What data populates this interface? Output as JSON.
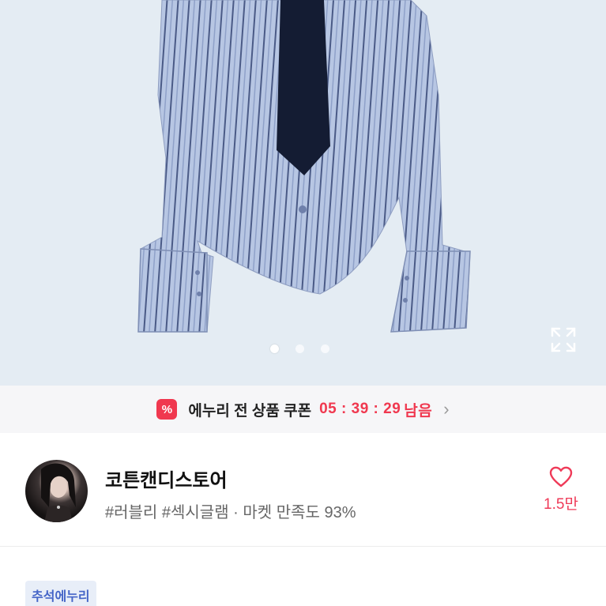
{
  "product_image": {
    "alt": "",
    "carousel": {
      "total": 3,
      "active": 1
    },
    "expand_icon": "expand-icon"
  },
  "coupon_bar": {
    "badge_symbol": "%",
    "text": "에누리 전 상품 쿠폰",
    "timer": "05 : 39 : 29",
    "timer_suffix": "남음",
    "chevron": "›",
    "accent_color": "#f0384f"
  },
  "store": {
    "name": "코튼캔디스토어",
    "tags": "#러블리 #섹시글램 · 마켓 만족도 93%",
    "like_icon": "heart-icon",
    "like_count": "1.5만"
  },
  "badges": {
    "event_label": "추석에누리"
  }
}
